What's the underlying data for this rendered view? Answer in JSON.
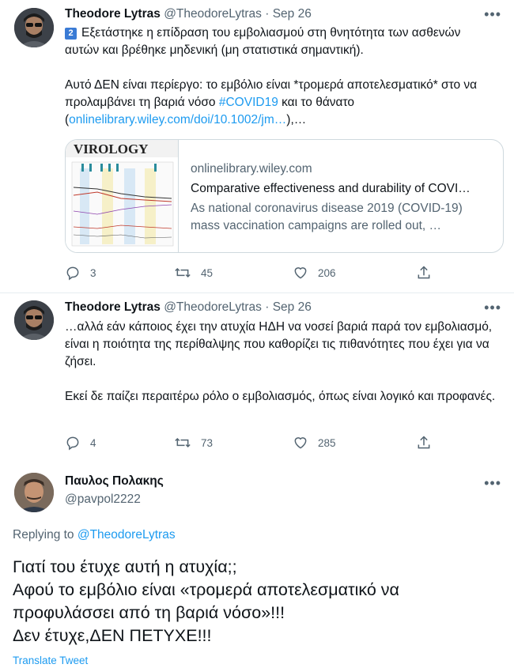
{
  "tweets": [
    {
      "author_name": "Theodore Lytras",
      "author_handle": "@TheodoreLytras",
      "date": "Sep 26",
      "badge": "2",
      "line1": "Εξετάστηκε η επίδραση του εμβολιασμού στη θνητότητα των ασθενών αυτών και βρέθηκε μηδενική (μη στατιστικά σημαντική).",
      "line2a": "Αυτό ΔΕΝ είναι περίεργο: το εμβόλιο είναι *τρομερά αποτελεσματικό* στο να προλαμβάνει τη βαριά νόσο ",
      "hashtag": "#COVID19",
      "line2b": " και το θάνατο (",
      "link": "onlinelibrary.wiley.com/doi/10.1002/jm…",
      "line2c": "),…",
      "card": {
        "thumb_title": "VIROLOGY",
        "domain": "onlinelibrary.wiley.com",
        "title": "Comparative effectiveness and durability of COVI…",
        "desc_line1": "As national coronavirus disease 2019 (COVID-19)",
        "desc_line2": "mass vaccination campaigns are rolled out, …"
      },
      "replies": "3",
      "retweets": "45",
      "likes": "206"
    },
    {
      "author_name": "Theodore Lytras",
      "author_handle": "@TheodoreLytras",
      "date": "Sep 26",
      "para1": "…αλλά εάν κάποιος έχει την ατυχία ΗΔΗ να νοσεί βαριά παρά τον εμβολιασμό, είναι η ποιότητα της περίθαλψης που καθορίζει τις πιθανότητες που έχει για να ζήσει.",
      "para2": "Εκεί δε παίζει περαιτέρω ρόλο ο εμβολιασμός, όπως είναι λογικό και προφανές.",
      "replies": "4",
      "retweets": "73",
      "likes": "285"
    }
  ],
  "reply": {
    "author_name": "Παυλος Πολακης",
    "author_handle": "@pavpol2222",
    "replying_prefix": "Replying to ",
    "replying_to": "@TheodoreLytras",
    "text_line1": "Γιατί του έτυχε αυτή η ατυχία;;",
    "text_line2": "Αφού το εμβόλιο είναι «τρομερά αποτελεσματικό να",
    "text_line3": "προφυλάσσει από τη βαριά νόσο»!!!",
    "text_line4": "Δεν έτυχε,ΔΕΝ ΠΕΤΥΧΕ!!!",
    "translate": "Translate Tweet"
  },
  "colors": {
    "accent": "#1d9bf0",
    "muted": "#536471",
    "divider": "#e6ecf0"
  },
  "icons": [
    "reply-icon",
    "retweet-icon",
    "like-icon",
    "share-icon",
    "more-icon"
  ]
}
